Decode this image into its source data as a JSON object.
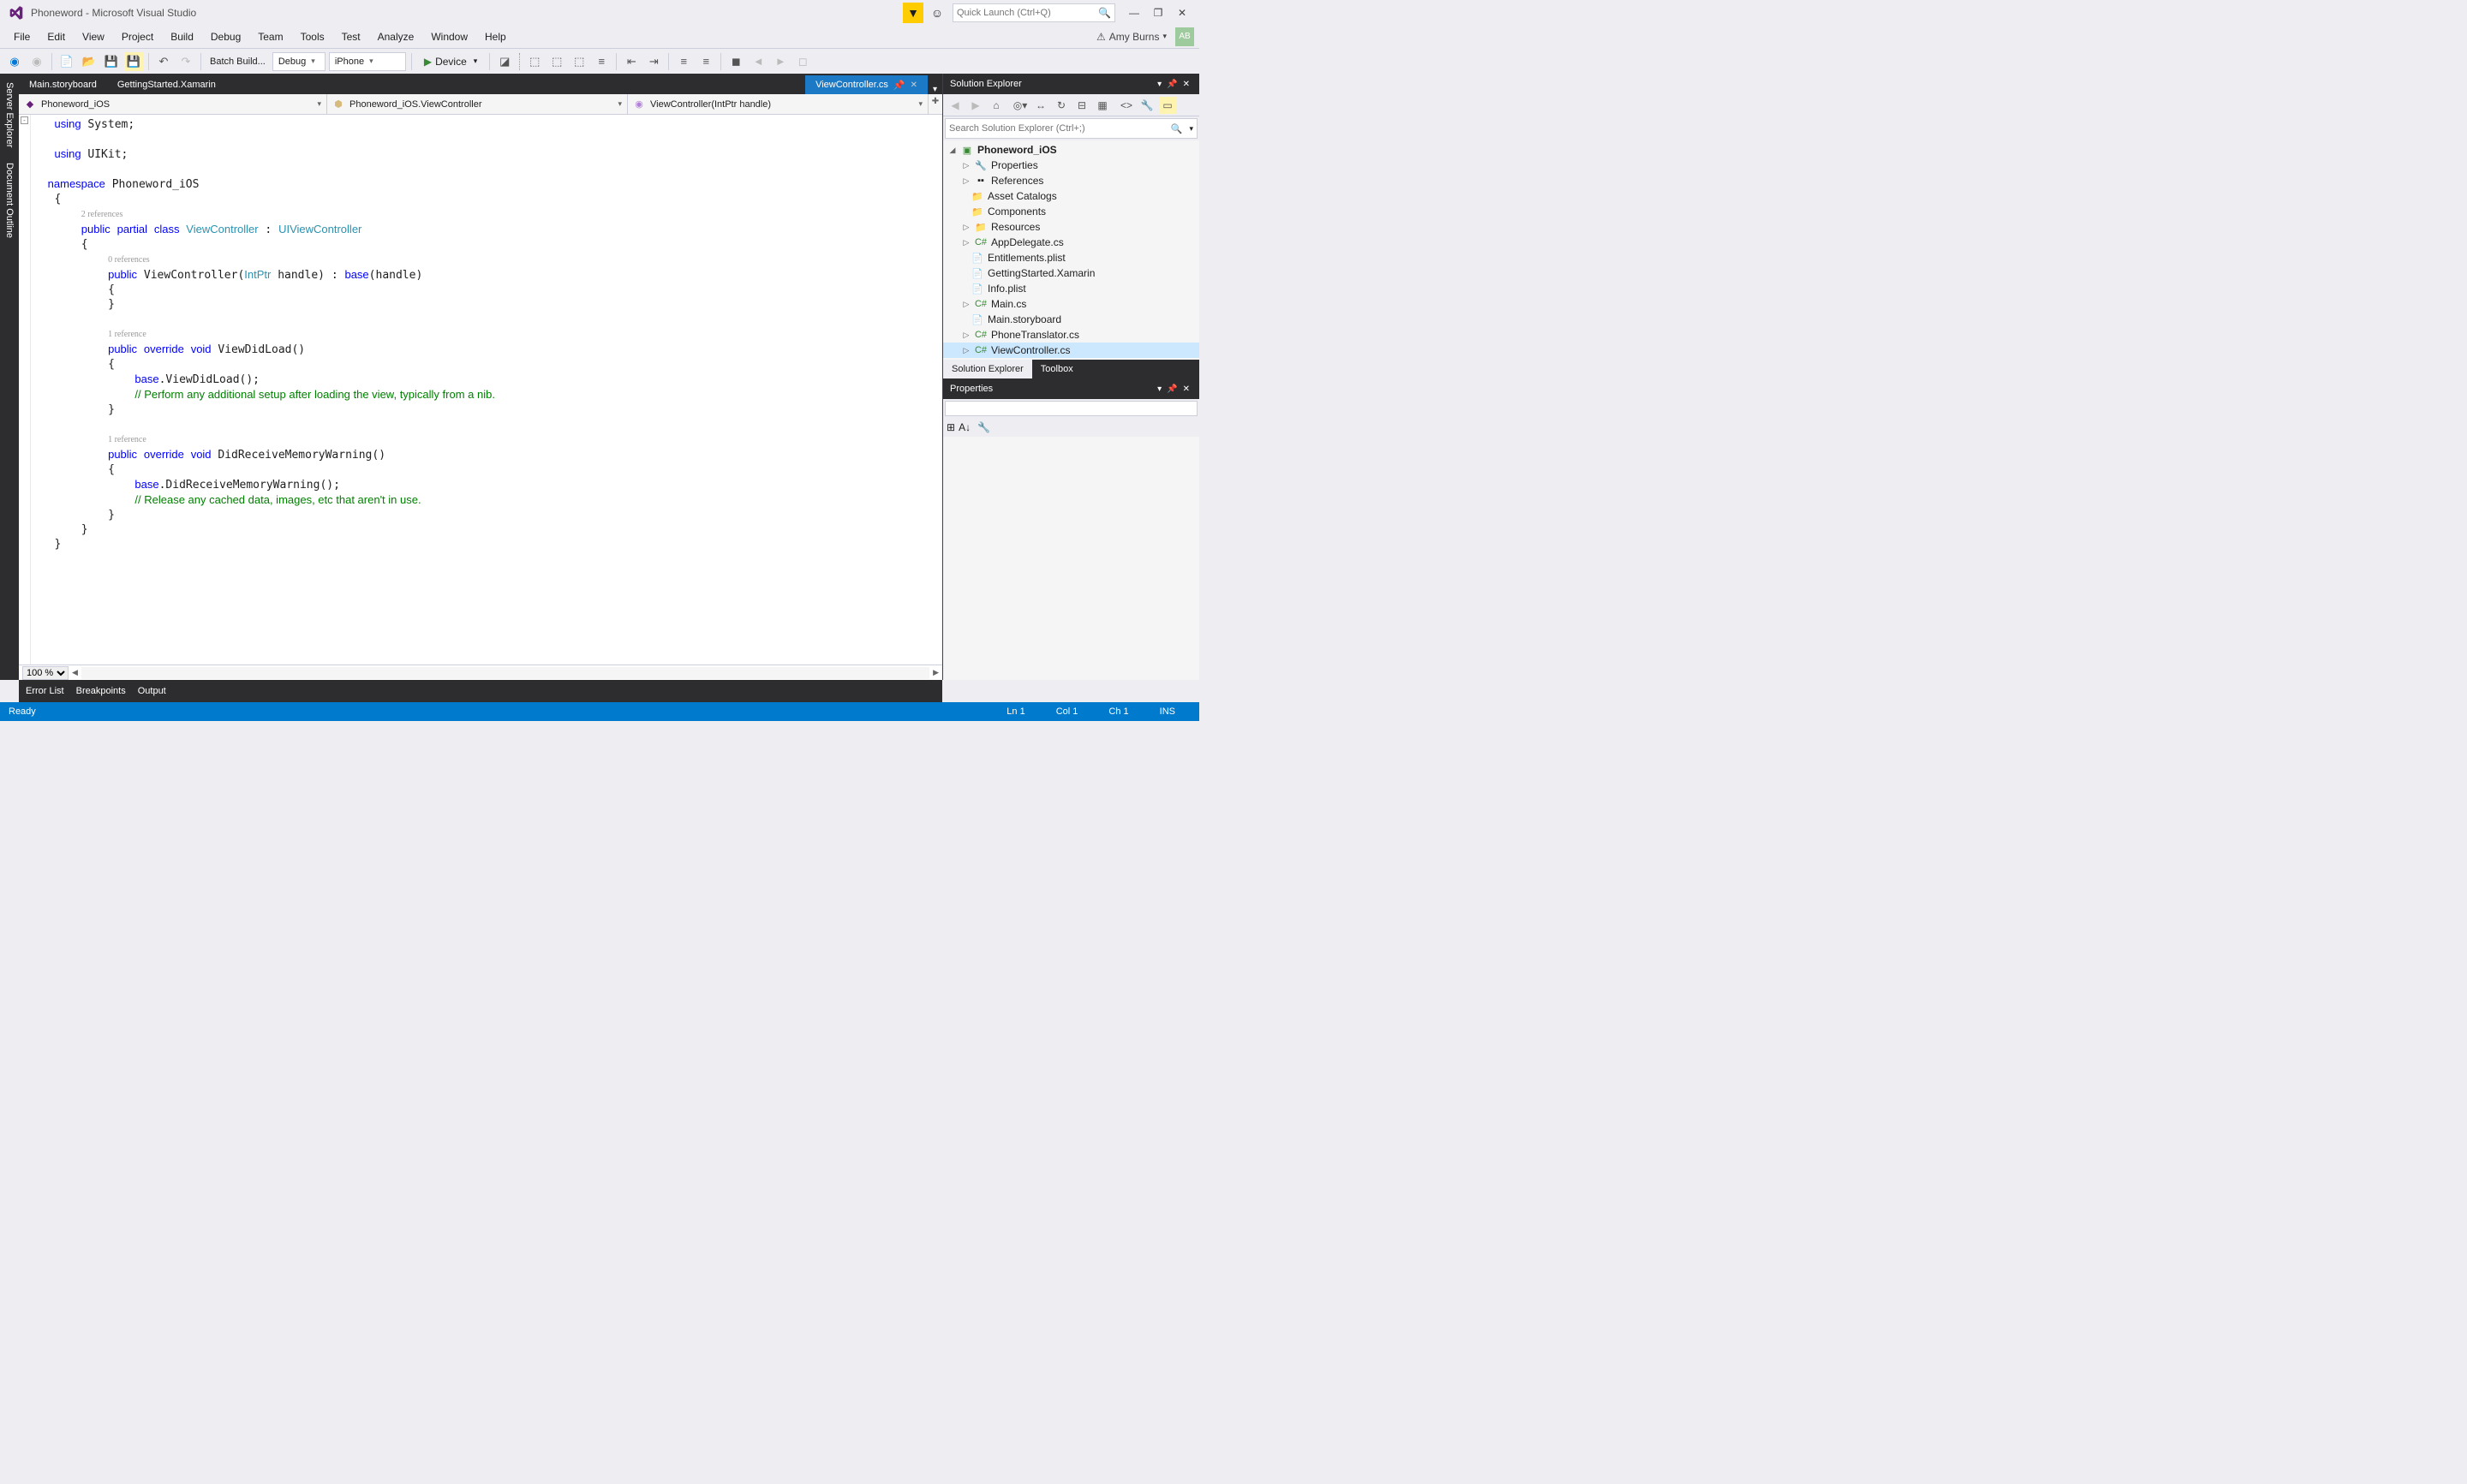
{
  "window": {
    "title": "Phoneword - Microsoft Visual Studio",
    "quick_launch_placeholder": "Quick Launch (Ctrl+Q)",
    "user_name": "Amy Burns",
    "user_initials": "AB"
  },
  "menu": [
    "File",
    "Edit",
    "View",
    "Project",
    "Build",
    "Debug",
    "Team",
    "Tools",
    "Test",
    "Analyze",
    "Window",
    "Help"
  ],
  "toolbar": {
    "batch_build": "Batch Build...",
    "config": "Debug",
    "platform": "iPhone",
    "start_label": "Device"
  },
  "tabs": {
    "items": [
      {
        "label": "Main.storyboard",
        "active": false
      },
      {
        "label": "GettingStarted.Xamarin",
        "active": false
      }
    ],
    "active_tab": "ViewController.cs"
  },
  "navbar": {
    "project": "Phoneword_iOS",
    "class": "Phoneword_iOS.ViewController",
    "member": "ViewController(IntPtr handle)"
  },
  "code": {
    "line1": "using System;",
    "line2": "using UIKit;",
    "ns": "namespace Phoneword_iOS",
    "ref2": "2 references",
    "classdecl_pub": "public",
    "classdecl_partial": "partial",
    "classdecl_class": "class",
    "classdecl_name": "ViewController",
    "classdecl_base": "UIViewController",
    "ref0": "0 references",
    "ctor": "public ViewController(IntPtr handle) : base(handle)",
    "ref1a": "1 reference",
    "vdl": "public override void ViewDidLoad()",
    "vdl_base": "base.ViewDidLoad();",
    "vdl_cm": "// Perform any additional setup after loading the view, typically from a nib.",
    "ref1b": "1 reference",
    "drm": "public override void DidReceiveMemoryWarning()",
    "drm_base": "base.DidReceiveMemoryWarning();",
    "drm_cm": "// Release any cached data, images, etc that aren't in use."
  },
  "zoom_level": "100 %",
  "left_tabs": [
    "Server Explorer",
    "Document Outline"
  ],
  "solution_explorer": {
    "title": "Solution Explorer",
    "search_placeholder": "Search Solution Explorer (Ctrl+;)",
    "root": "Phoneword_iOS",
    "nodes": [
      {
        "label": "Properties",
        "icon": "wrench",
        "expandable": true
      },
      {
        "label": "References",
        "icon": "refs",
        "expandable": true
      },
      {
        "label": "Asset Catalogs",
        "icon": "folder",
        "expandable": false
      },
      {
        "label": "Components",
        "icon": "folder",
        "expandable": false
      },
      {
        "label": "Resources",
        "icon": "folder",
        "expandable": true
      },
      {
        "label": "AppDelegate.cs",
        "icon": "cs",
        "expandable": true
      },
      {
        "label": "Entitlements.plist",
        "icon": "file",
        "expandable": false
      },
      {
        "label": "GettingStarted.Xamarin",
        "icon": "file",
        "expandable": false
      },
      {
        "label": "Info.plist",
        "icon": "file",
        "expandable": false
      },
      {
        "label": "Main.cs",
        "icon": "cs",
        "expandable": true
      },
      {
        "label": "Main.storyboard",
        "icon": "file",
        "expandable": false
      },
      {
        "label": "PhoneTranslator.cs",
        "icon": "cs",
        "expandable": true
      },
      {
        "label": "ViewController.cs",
        "icon": "cs",
        "expandable": true,
        "selected": true
      }
    ]
  },
  "panel_tabs": {
    "solution_explorer": "Solution Explorer",
    "toolbox": "Toolbox"
  },
  "properties": {
    "title": "Properties"
  },
  "bottom_tabs": [
    "Error List",
    "Breakpoints",
    "Output"
  ],
  "status_bar": {
    "ready": "Ready",
    "line": "Ln 1",
    "col": "Col 1",
    "ch": "Ch 1",
    "ins": "INS"
  }
}
